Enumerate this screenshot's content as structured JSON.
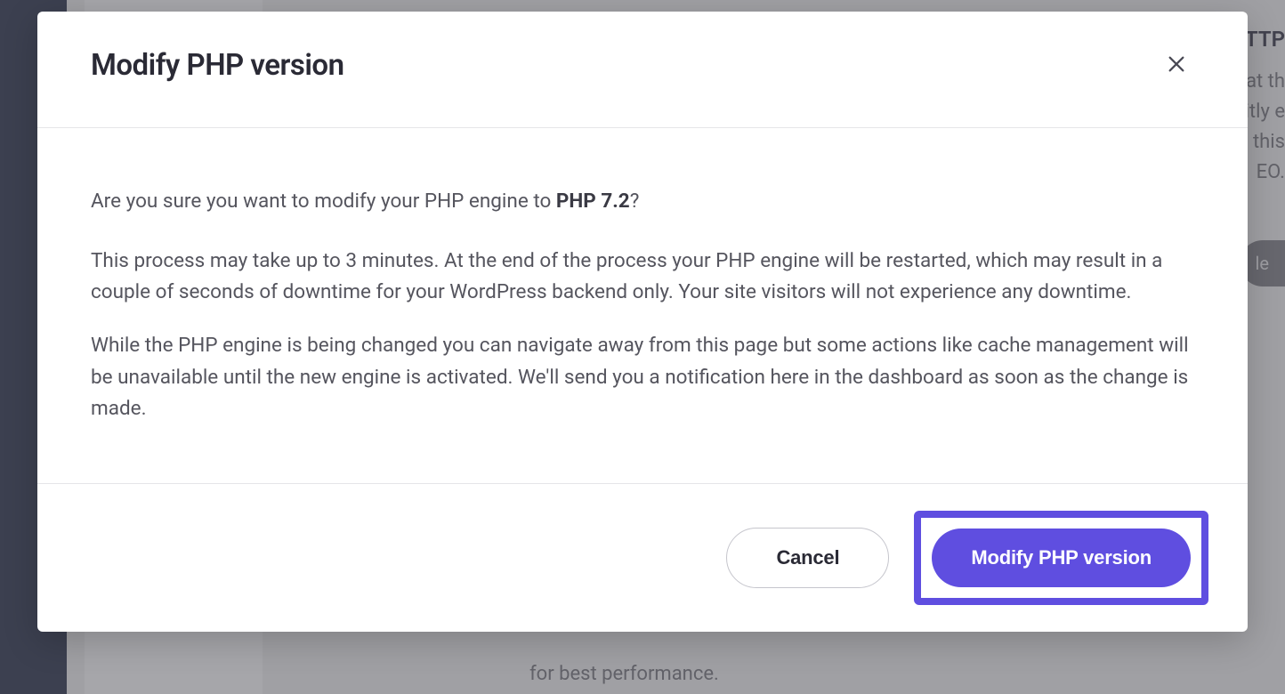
{
  "background": {
    "right_heading": "TTP",
    "right_desc_lines": [
      "at th",
      "itly e",
      " this",
      "EO."
    ],
    "right_button": "le",
    "bottom_text": "for best performance."
  },
  "modal": {
    "title": "Modify PHP version",
    "confirm_prefix": "Are you sure you want to modify your PHP engine to ",
    "confirm_version": "PHP 7.2",
    "confirm_suffix": "?",
    "para1": "This process may take up to 3 minutes. At the end of the process your PHP engine will be restarted, which may result in a couple of seconds of downtime for your WordPress backend only. Your site visitors will not experience any downtime.",
    "para2": "While the PHP engine is being changed you can navigate away from this page but some actions like cache management will be unavailable until the new engine is activated. We'll send you a notification here in the dashboard as soon as the change is made.",
    "cancel_label": "Cancel",
    "confirm_label": "Modify PHP version"
  }
}
